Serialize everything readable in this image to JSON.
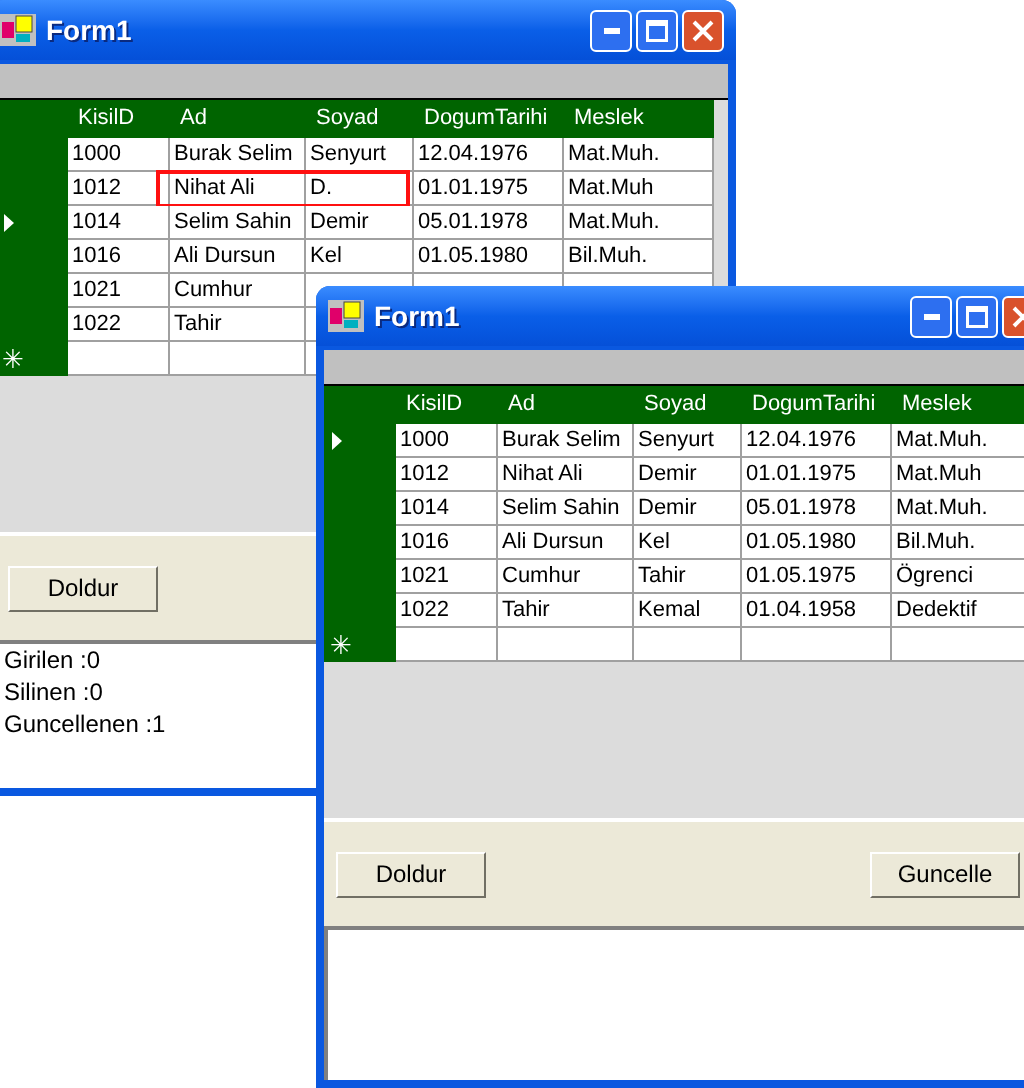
{
  "windows": [
    {
      "title": "Form1",
      "columns": [
        "KisilD",
        "Ad",
        "Soyad",
        "DogumTarihi",
        "Meslek"
      ],
      "rows": [
        {
          "selected": false,
          "annotated": false,
          "cells": [
            "1000",
            "Burak Selim",
            "Senyurt",
            "12.04.1976",
            "Mat.Muh."
          ]
        },
        {
          "selected": false,
          "annotated": true,
          "cells": [
            "1012",
            "Nihat Ali",
            "D.",
            "01.01.1975",
            "Mat.Muh"
          ]
        },
        {
          "selected": true,
          "annotated": false,
          "cells": [
            "1014",
            "Selim Sahin",
            "Demir",
            "05.01.1978",
            "Mat.Muh."
          ]
        },
        {
          "selected": false,
          "annotated": false,
          "cells": [
            "1016",
            "Ali Dursun",
            "Kel",
            "01.05.1980",
            "Bil.Muh."
          ]
        },
        {
          "selected": false,
          "annotated": false,
          "cells": [
            "1021",
            "Cumhur"
          ]
        },
        {
          "selected": false,
          "annotated": false,
          "cells": [
            "1022",
            "Tahir"
          ]
        }
      ],
      "new_row_marker": "✳",
      "buttons": [
        "Doldur"
      ],
      "log": [
        "Girilen :0",
        "Silinen :0",
        "Guncellenen :1"
      ]
    },
    {
      "title": "Form1",
      "columns": [
        "KisilD",
        "Ad",
        "Soyad",
        "DogumTarihi",
        "Meslek"
      ],
      "rows": [
        {
          "selected": true,
          "annotated": false,
          "cells": [
            "1000",
            "Burak Selim",
            "Senyurt",
            "12.04.1976",
            "Mat.Muh."
          ]
        },
        {
          "selected": false,
          "annotated": false,
          "cells": [
            "1012",
            "Nihat Ali",
            "Demir",
            "01.01.1975",
            "Mat.Muh"
          ]
        },
        {
          "selected": false,
          "annotated": false,
          "cells": [
            "1014",
            "Selim Sahin",
            "Demir",
            "05.01.1978",
            "Mat.Muh."
          ]
        },
        {
          "selected": false,
          "annotated": false,
          "cells": [
            "1016",
            "Ali Dursun",
            "Kel",
            "01.05.1980",
            "Bil.Muh."
          ]
        },
        {
          "selected": false,
          "annotated": false,
          "cells": [
            "1021",
            "Cumhur",
            "Tahir",
            "01.05.1975",
            "Ögrenci"
          ]
        },
        {
          "selected": false,
          "annotated": false,
          "cells": [
            "1022",
            "Tahir",
            "Kemal",
            "01.04.1958",
            "Dedektif"
          ]
        }
      ],
      "new_row_marker": "✳",
      "buttons": [
        "Doldur",
        "Guncelle"
      ]
    }
  ]
}
